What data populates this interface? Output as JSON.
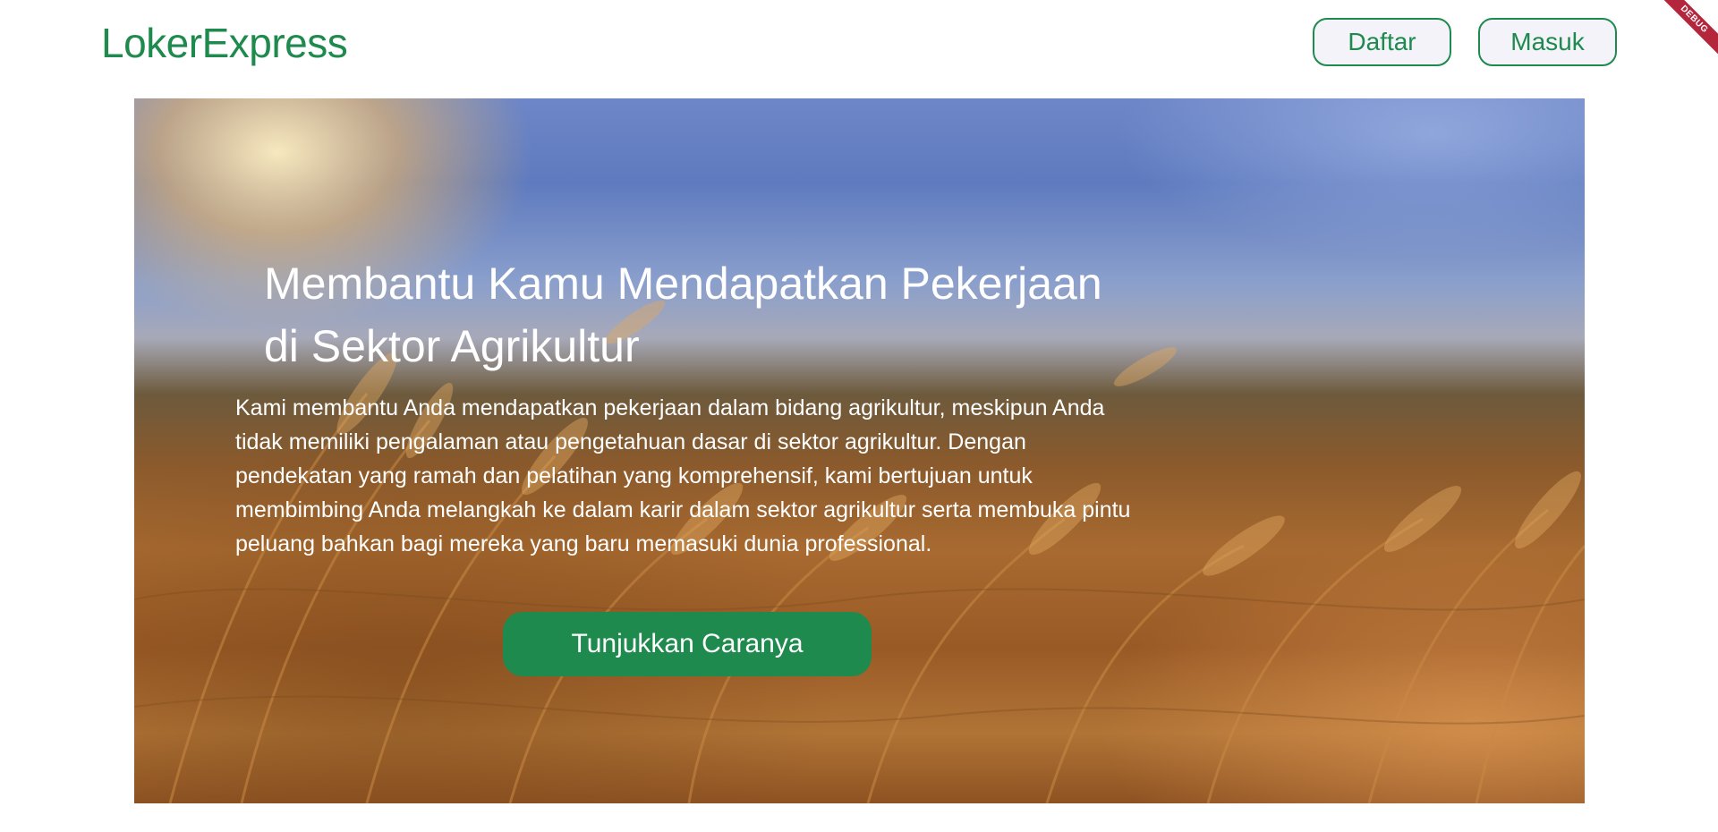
{
  "header": {
    "brand": "LokerExpress",
    "register_label": "Daftar",
    "login_label": "Masuk"
  },
  "debug_banner": "DEBUG",
  "hero": {
    "title_line1": "Membantu Kamu Mendapatkan Pekerjaan",
    "title_line2": "di Sektor Agrikultur",
    "description": "Kami membantu Anda mendapatkan pekerjaan dalam bidang agrikultur, meskipun Anda tidak memiliki pengalaman atau pengetahuan dasar di sektor agrikultur. Dengan pendekatan yang ramah dan pelatihan yang komprehensif, kami bertujuan untuk membimbing Anda melangkah ke dalam karir dalam sektor agrikultur serta membuka pintu peluang bahkan bagi mereka yang baru memasuki dunia professional.",
    "cta_label": "Tunjukkan Caranya",
    "background_image": "wheat-field-photo"
  },
  "colors": {
    "brand_green": "#1f8a4e",
    "header_button_bg": "#f3f3f9",
    "debug_red": "#b3263b"
  }
}
